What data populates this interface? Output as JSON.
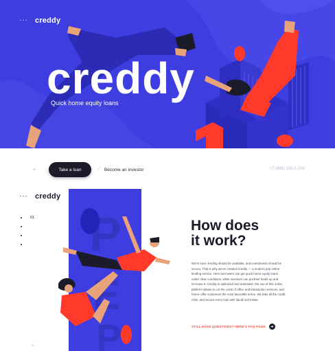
{
  "brand": {
    "logo": "creddy",
    "menu_glyph": "···"
  },
  "hero": {
    "title": "creddy",
    "subtitle": "Quick home equity loans"
  },
  "nav": {
    "chevron": "⌄",
    "take_loan": "Take a loan",
    "invest_icon": "⟋",
    "become_investor": "Become an investor",
    "phone": "+7 (495) 150-1-150"
  },
  "section2": {
    "step": "01",
    "title_line1": "How does",
    "title_line2": "it work?",
    "body": "We're sure: lending should be available, and investments should be secure. That is why we've created Creddy — a modern p2p online lending service. Here borrowers can get quick home equity loans under clear conditions, while investors can put their funds up and increase it. Creddy is optimized and automatic: the use of this online platform allows to cut the costs of office and transaction services, and hence offer customers the most favorable terms. We take all the credit risks, and secure every loan with liquid real estate.",
    "faq_link": "STILL HAVE QUESTIONS? HERE'S FAQ PAGE",
    "faq_arrow": "➜",
    "bottom_chevron": "⌄"
  },
  "colors": {
    "primary_blue": "#3d3de0",
    "accent_red": "#ff3a2a",
    "dark": "#1b1b2a"
  },
  "icons": [
    "menu-dots-icon",
    "chevron-down-icon",
    "pencil-icon",
    "arrow-right-icon"
  ]
}
